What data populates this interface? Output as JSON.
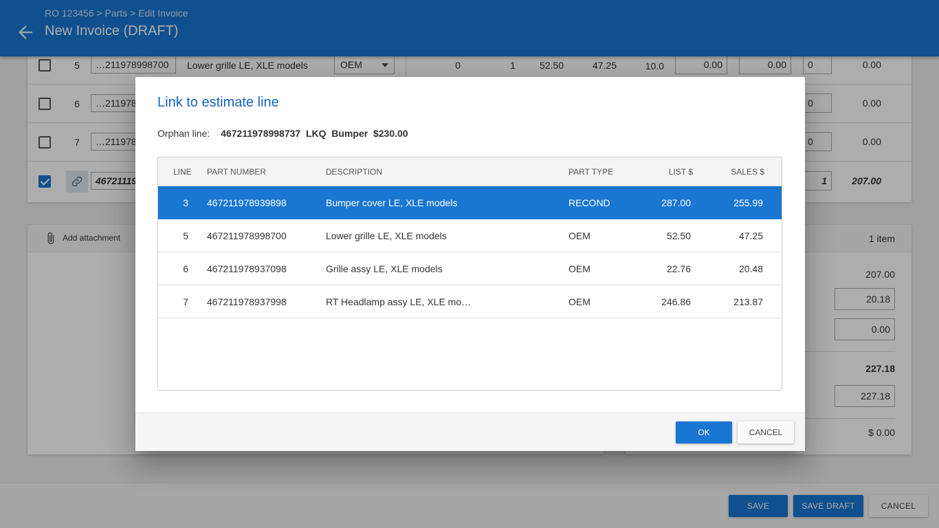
{
  "header": {
    "breadcrumb": "RO 123456 > Parts > Edit Invoice",
    "title": "New Invoice (DRAFT)",
    "back_icon": "arrow-left-icon"
  },
  "invoice_lines": [
    {
      "line": "5",
      "part_number": "…211978998700",
      "description": "Lower grille LE, XLE models",
      "part_type": "OEM",
      "qty_a": "0",
      "qty_b": "1",
      "list": "52.50",
      "sales": "47.25",
      "pct": "10.0",
      "fld1": "0.00",
      "fld2": "0.00",
      "fld3": "0",
      "total": "0.00",
      "checked": false
    },
    {
      "line": "6",
      "part_number": "…211978",
      "fld3": "0",
      "total": "0.00",
      "checked": false
    },
    {
      "line": "7",
      "part_number": "…211978",
      "fld3": "0",
      "total": "0.00",
      "checked": false
    },
    {
      "part_number": "46721119",
      "fld3": "1",
      "total": "207.00",
      "checked": true
    }
  ],
  "attachments": {
    "add_label": "Add attachment"
  },
  "totals": {
    "items_count": "1 item",
    "subtotal": "207.00",
    "tax": "20.18",
    "other": "0.00",
    "total": "227.18",
    "paid": "227.18",
    "balance": "$ 0.00"
  },
  "footer": {
    "save": "SAVE",
    "save_draft": "SAVE DRAFT",
    "cancel": "CANCEL"
  },
  "dialog": {
    "title": "Link to estimate line",
    "orphan_label": "Orphan line:",
    "orphan_value": "467211978998737  LKQ  Bumper  $230.00",
    "columns": {
      "line": "LINE",
      "part_number": "PART NUMBER",
      "description": "DESCRIPTION",
      "part_type": "PART TYPE",
      "list": "LIST $",
      "sales": "SALES $"
    },
    "rows": [
      {
        "line": "3",
        "part_number": "467211978939898",
        "description": "Bumper cover LE, XLE models",
        "part_type": "RECOND",
        "list": "287.00",
        "sales": "255.99"
      },
      {
        "line": "5",
        "part_number": "467211978998700",
        "description": "Lower grille LE, XLE models",
        "part_type": "OEM",
        "list": "52.50",
        "sales": "47.25"
      },
      {
        "line": "6",
        "part_number": "467211978937098",
        "description": "Grille assy LE, XLE models",
        "part_type": "OEM",
        "list": "22.76",
        "sales": "20.48"
      },
      {
        "line": "7",
        "part_number": "467211978937998",
        "description": "RT Headlamp assy LE, XLE mo…",
        "part_type": "OEM",
        "list": "246.86",
        "sales": "213.87"
      }
    ],
    "selected_index": 0,
    "ok": "OK",
    "cancel": "CANCEL"
  },
  "colors": {
    "primary": "#1976d2",
    "title_blue": "#1565c0"
  }
}
